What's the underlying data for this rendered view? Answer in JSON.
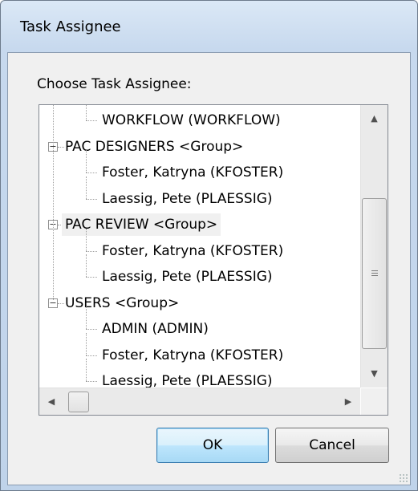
{
  "window": {
    "title": "Task Assignee"
  },
  "dialog": {
    "label": "Choose Task Assignee:"
  },
  "tree": {
    "rows": [
      {
        "text": "WORKFLOW (WORKFLOW)",
        "kind": "child"
      },
      {
        "text": "PAC DESIGNERS <Group>",
        "kind": "group",
        "expanded": true
      },
      {
        "text": "Foster, Katryna (KFOSTER)",
        "kind": "child"
      },
      {
        "text": "Laessig, Pete (PLAESSIG)",
        "kind": "child"
      },
      {
        "text": "PAC REVIEW <Group>",
        "kind": "group",
        "expanded": true,
        "selected": true
      },
      {
        "text": "Foster, Katryna (KFOSTER)",
        "kind": "child"
      },
      {
        "text": "Laessig, Pete (PLAESSIG)",
        "kind": "child"
      },
      {
        "text": "USERS <Group>",
        "kind": "group",
        "expanded": true
      },
      {
        "text": "ADMIN (ADMIN)",
        "kind": "child"
      },
      {
        "text": "Foster, Katryna (KFOSTER)",
        "kind": "child"
      },
      {
        "text": "Laessig, Pete (PLAESSIG)",
        "kind": "child"
      }
    ],
    "expander_symbol": "−",
    "scroll": {
      "up_arrow": "▲",
      "down_arrow": "▼",
      "left_arrow": "◀",
      "right_arrow": "▶"
    }
  },
  "buttons": {
    "ok": "OK",
    "cancel": "Cancel"
  }
}
